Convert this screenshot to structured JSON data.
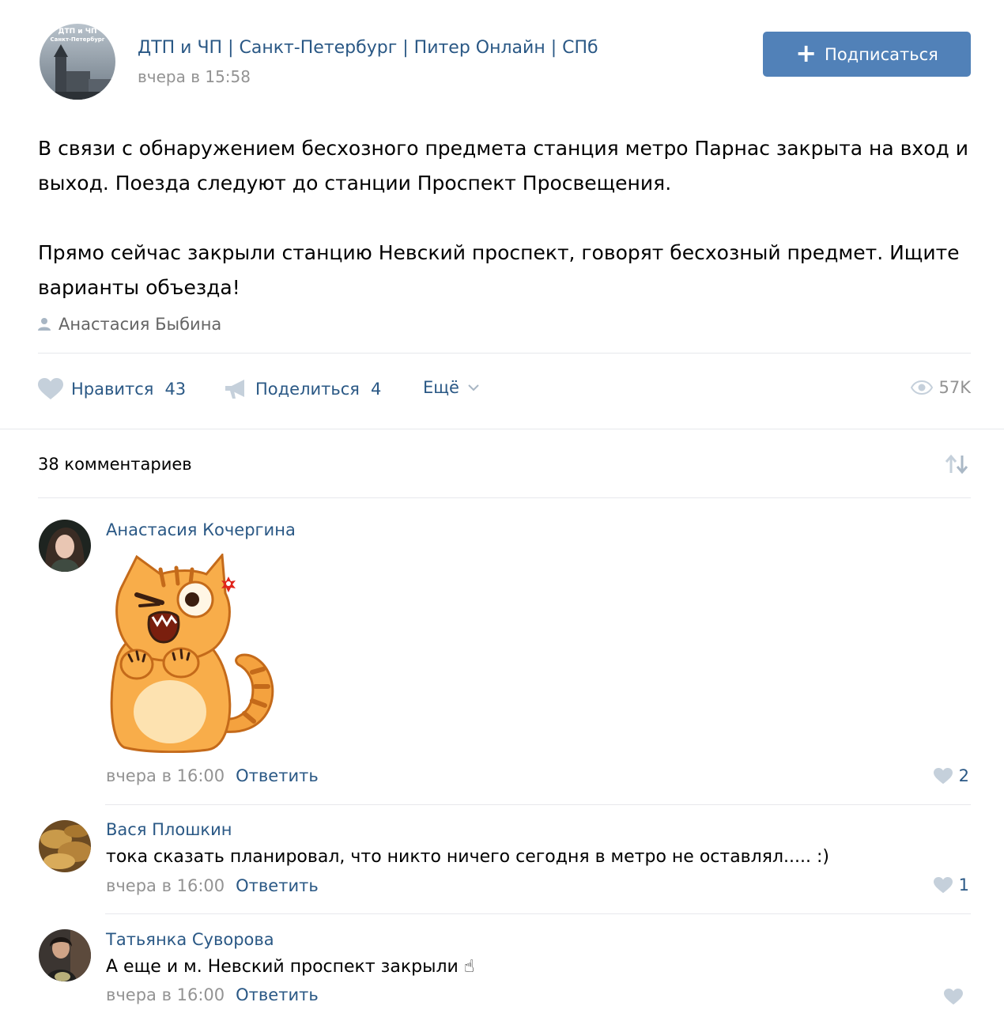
{
  "post": {
    "group_name": "ДТП и ЧП | Санкт-Петербург | Питер Онлайн | СПб",
    "avatar_text": "ДТП и ЧП Санкт-Петербург",
    "time": "вчера в 15:58",
    "subscribe_label": "Подписаться",
    "paragraphs": [
      "В связи с обнаружением бесхозного предмета станция метро Парнас закрыта на вход и выход. Поезда следуют до станции Проспект Просвещения.",
      "Прямо сейчас закрыли станцию Невский проспект, говорят бесхозный предмет. Ищите варианты объезда!"
    ],
    "signer": "Анастасия Быбина"
  },
  "actions": {
    "like_label": "Нравится",
    "like_count": "43",
    "share_label": "Поделиться",
    "share_count": "4",
    "more_label": "Ещё",
    "views": "57K"
  },
  "comments_header": "38 комментариев",
  "comments": [
    {
      "author": "Анастасия Кочергина",
      "text": "",
      "time": "вчера в 16:00",
      "reply": "Ответить",
      "likes": "2",
      "has_sticker": true
    },
    {
      "author": "Вася Плошкин",
      "text": "тока сказать планировал, что никто ничего сегодня в метро не оставлял..... :)",
      "time": "вчера в 16:00",
      "reply": "Ответить",
      "likes": "1"
    },
    {
      "author": "Татьянка Суворова",
      "text": "А еще и м. Невский проспект закрыли ☝",
      "time": "вчера в 16:00",
      "reply": "Ответить",
      "likes": ""
    }
  ],
  "colors": {
    "link": "#2a5885",
    "button": "#5181b8",
    "muted": "#939393",
    "divider": "#e7e8ec",
    "icon": "#c5d0db"
  }
}
